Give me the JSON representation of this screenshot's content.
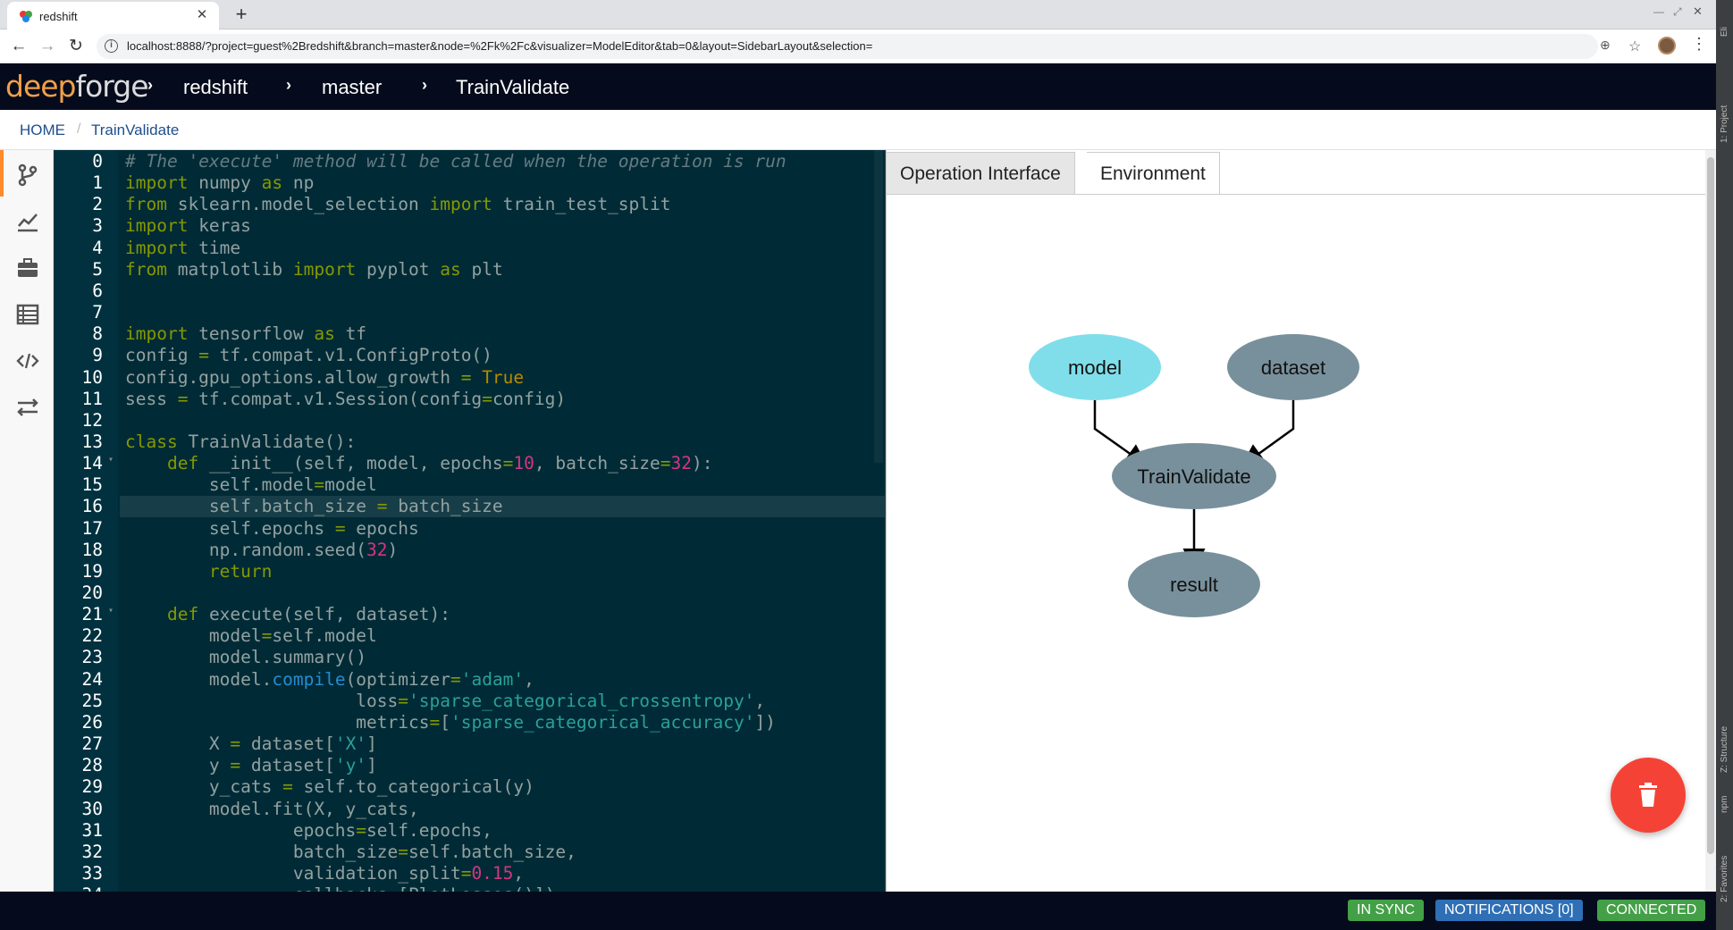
{
  "browser": {
    "tab_title": "redshift",
    "url": "localhost:8888/?project=guest%2Bredshift&branch=master&node=%2Fk%2Fc&visualizer=ModelEditor&tab=0&layout=SidebarLayout&selection="
  },
  "ide_strip": {
    "top_label": "Eli",
    "project_label": "1: Project",
    "structure_label": "Z: Structure",
    "npm_label": "npm",
    "favorites_label": "2: Favorites"
  },
  "header": {
    "logo_part1": "deep",
    "logo_part2": "forge",
    "crumbs": [
      "redshift",
      "master",
      "TrainValidate"
    ]
  },
  "breadcrumb": {
    "home": "HOME",
    "current": "TrainValidate"
  },
  "sidebar": {
    "items": [
      "branch-icon",
      "chart-line-icon",
      "briefcase-icon",
      "table-icon",
      "code-icon",
      "exchange-icon"
    ]
  },
  "editor": {
    "highlighted_line": 16,
    "lines": [
      {
        "n": "0",
        "fold": false,
        "tokens": [
          {
            "t": "c",
            "v": "# The 'execute' method will be called when the operation is run"
          }
        ]
      },
      {
        "n": "1",
        "fold": false,
        "tokens": [
          {
            "t": "k",
            "v": "import"
          },
          {
            "t": "p",
            "v": " numpy "
          },
          {
            "t": "k",
            "v": "as"
          },
          {
            "t": "p",
            "v": " np"
          }
        ]
      },
      {
        "n": "2",
        "fold": false,
        "tokens": [
          {
            "t": "k",
            "v": "from"
          },
          {
            "t": "p",
            "v": " sklearn.model_selection "
          },
          {
            "t": "k",
            "v": "import"
          },
          {
            "t": "p",
            "v": " train_test_split"
          }
        ]
      },
      {
        "n": "3",
        "fold": false,
        "tokens": [
          {
            "t": "k",
            "v": "import"
          },
          {
            "t": "p",
            "v": " keras"
          }
        ]
      },
      {
        "n": "4",
        "fold": false,
        "tokens": [
          {
            "t": "k",
            "v": "import"
          },
          {
            "t": "p",
            "v": " time"
          }
        ]
      },
      {
        "n": "5",
        "fold": false,
        "tokens": [
          {
            "t": "k",
            "v": "from"
          },
          {
            "t": "p",
            "v": " matplotlib "
          },
          {
            "t": "k",
            "v": "import"
          },
          {
            "t": "p",
            "v": " pyplot "
          },
          {
            "t": "k",
            "v": "as"
          },
          {
            "t": "p",
            "v": " plt"
          }
        ]
      },
      {
        "n": "6",
        "fold": false,
        "tokens": []
      },
      {
        "n": "7",
        "fold": false,
        "tokens": []
      },
      {
        "n": "8",
        "fold": false,
        "tokens": [
          {
            "t": "k",
            "v": "import"
          },
          {
            "t": "p",
            "v": " tensorflow "
          },
          {
            "t": "k",
            "v": "as"
          },
          {
            "t": "p",
            "v": " tf"
          }
        ]
      },
      {
        "n": "9",
        "fold": false,
        "tokens": [
          {
            "t": "p",
            "v": "config "
          },
          {
            "t": "k",
            "v": "="
          },
          {
            "t": "p",
            "v": " tf.compat.v1.ConfigProto()"
          }
        ]
      },
      {
        "n": "10",
        "fold": false,
        "tokens": [
          {
            "t": "p",
            "v": "config.gpu_options.allow_growth "
          },
          {
            "t": "k",
            "v": "="
          },
          {
            "t": "p",
            "v": " "
          },
          {
            "t": "b",
            "v": "True"
          }
        ]
      },
      {
        "n": "11",
        "fold": false,
        "tokens": [
          {
            "t": "p",
            "v": "sess "
          },
          {
            "t": "k",
            "v": "="
          },
          {
            "t": "p",
            "v": " tf.compat.v1.Session(config"
          },
          {
            "t": "k",
            "v": "="
          },
          {
            "t": "p",
            "v": "config)"
          }
        ]
      },
      {
        "n": "12",
        "fold": false,
        "tokens": []
      },
      {
        "n": "13",
        "fold": false,
        "tokens": [
          {
            "t": "k",
            "v": "class"
          },
          {
            "t": "p",
            "v": " TrainValidate():"
          }
        ]
      },
      {
        "n": "14",
        "fold": true,
        "tokens": [
          {
            "t": "p",
            "v": "    "
          },
          {
            "t": "k",
            "v": "def"
          },
          {
            "t": "p",
            "v": " __init__(self, model, epochs"
          },
          {
            "t": "k",
            "v": "="
          },
          {
            "t": "n",
            "v": "10"
          },
          {
            "t": "p",
            "v": ", batch_size"
          },
          {
            "t": "k",
            "v": "="
          },
          {
            "t": "n",
            "v": "32"
          },
          {
            "t": "p",
            "v": "):"
          }
        ]
      },
      {
        "n": "15",
        "fold": false,
        "tokens": [
          {
            "t": "p",
            "v": "        self.model"
          },
          {
            "t": "k",
            "v": "="
          },
          {
            "t": "p",
            "v": "model"
          }
        ]
      },
      {
        "n": "16",
        "fold": false,
        "tokens": [
          {
            "t": "p",
            "v": "        self.batch_size "
          },
          {
            "t": "k",
            "v": "="
          },
          {
            "t": "p",
            "v": " batch_size"
          }
        ]
      },
      {
        "n": "17",
        "fold": false,
        "tokens": [
          {
            "t": "p",
            "v": "        self.epochs "
          },
          {
            "t": "k",
            "v": "="
          },
          {
            "t": "p",
            "v": " epochs"
          }
        ]
      },
      {
        "n": "18",
        "fold": false,
        "tokens": [
          {
            "t": "p",
            "v": "        np.random.seed("
          },
          {
            "t": "n",
            "v": "32"
          },
          {
            "t": "p",
            "v": ")"
          }
        ]
      },
      {
        "n": "19",
        "fold": false,
        "tokens": [
          {
            "t": "p",
            "v": "        "
          },
          {
            "t": "k",
            "v": "return"
          }
        ]
      },
      {
        "n": "20",
        "fold": false,
        "tokens": []
      },
      {
        "n": "21",
        "fold": true,
        "tokens": [
          {
            "t": "p",
            "v": "    "
          },
          {
            "t": "k",
            "v": "def"
          },
          {
            "t": "p",
            "v": " execute(self, dataset):"
          }
        ]
      },
      {
        "n": "22",
        "fold": false,
        "tokens": [
          {
            "t": "p",
            "v": "        model"
          },
          {
            "t": "k",
            "v": "="
          },
          {
            "t": "p",
            "v": "self.model"
          }
        ]
      },
      {
        "n": "23",
        "fold": false,
        "tokens": [
          {
            "t": "p",
            "v": "        model.summary()"
          }
        ]
      },
      {
        "n": "24",
        "fold": false,
        "tokens": [
          {
            "t": "p",
            "v": "        model."
          },
          {
            "t": "f",
            "v": "compile"
          },
          {
            "t": "p",
            "v": "(optimizer"
          },
          {
            "t": "k",
            "v": "="
          },
          {
            "t": "s",
            "v": "'adam'"
          },
          {
            "t": "p",
            "v": ","
          }
        ]
      },
      {
        "n": "25",
        "fold": false,
        "tokens": [
          {
            "t": "p",
            "v": "                      loss"
          },
          {
            "t": "k",
            "v": "="
          },
          {
            "t": "s",
            "v": "'sparse_categorical_crossentropy'"
          },
          {
            "t": "p",
            "v": ","
          }
        ]
      },
      {
        "n": "26",
        "fold": false,
        "tokens": [
          {
            "t": "p",
            "v": "                      metrics"
          },
          {
            "t": "k",
            "v": "="
          },
          {
            "t": "p",
            "v": "["
          },
          {
            "t": "s",
            "v": "'sparse_categorical_accuracy'"
          },
          {
            "t": "p",
            "v": "])"
          }
        ]
      },
      {
        "n": "27",
        "fold": false,
        "tokens": [
          {
            "t": "p",
            "v": "        X "
          },
          {
            "t": "k",
            "v": "="
          },
          {
            "t": "p",
            "v": " dataset["
          },
          {
            "t": "s",
            "v": "'X'"
          },
          {
            "t": "p",
            "v": "]"
          }
        ]
      },
      {
        "n": "28",
        "fold": false,
        "tokens": [
          {
            "t": "p",
            "v": "        y "
          },
          {
            "t": "k",
            "v": "="
          },
          {
            "t": "p",
            "v": " dataset["
          },
          {
            "t": "s",
            "v": "'y'"
          },
          {
            "t": "p",
            "v": "]"
          }
        ]
      },
      {
        "n": "29",
        "fold": false,
        "tokens": [
          {
            "t": "p",
            "v": "        y_cats "
          },
          {
            "t": "k",
            "v": "="
          },
          {
            "t": "p",
            "v": " self.to_categorical(y)"
          }
        ]
      },
      {
        "n": "30",
        "fold": false,
        "tokens": [
          {
            "t": "p",
            "v": "        model.fit(X, y_cats,"
          }
        ]
      },
      {
        "n": "31",
        "fold": false,
        "tokens": [
          {
            "t": "p",
            "v": "                epochs"
          },
          {
            "t": "k",
            "v": "="
          },
          {
            "t": "p",
            "v": "self.epochs,"
          }
        ]
      },
      {
        "n": "32",
        "fold": false,
        "tokens": [
          {
            "t": "p",
            "v": "                batch_size"
          },
          {
            "t": "k",
            "v": "="
          },
          {
            "t": "p",
            "v": "self.batch_size,"
          }
        ]
      },
      {
        "n": "33",
        "fold": false,
        "tokens": [
          {
            "t": "p",
            "v": "                validation_split"
          },
          {
            "t": "k",
            "v": "="
          },
          {
            "t": "n",
            "v": "0.15"
          },
          {
            "t": "p",
            "v": ","
          }
        ]
      },
      {
        "n": "34",
        "fold": false,
        "tokens": [
          {
            "t": "p",
            "v": "                callbacks"
          },
          {
            "t": "k",
            "v": "="
          },
          {
            "t": "p",
            "v": "[PlotLosses()])"
          }
        ]
      }
    ]
  },
  "panel": {
    "tabs": [
      "Operation Interface",
      "Environment"
    ],
    "active_tab": 0
  },
  "graph": {
    "nodes": [
      {
        "id": "model",
        "label": "model",
        "color": "#80deea"
      },
      {
        "id": "dataset",
        "label": "dataset",
        "color": "#78909c"
      },
      {
        "id": "op",
        "label": "TrainValidate",
        "color": "#78909c"
      },
      {
        "id": "result",
        "label": "result",
        "color": "#78909c"
      }
    ]
  },
  "fab": {
    "icon": "trash-icon",
    "color": "#f44336"
  },
  "footer": {
    "in_sync": "IN SYNC",
    "notifications": "NOTIFICATIONS [0]",
    "connected": "CONNECTED"
  },
  "colors": {
    "header_bg": "#050b1c",
    "editor_bg": "#002b36",
    "accent": "#ff8a2b",
    "sync_green": "#43a047",
    "notif_blue": "#2f6fb5"
  }
}
